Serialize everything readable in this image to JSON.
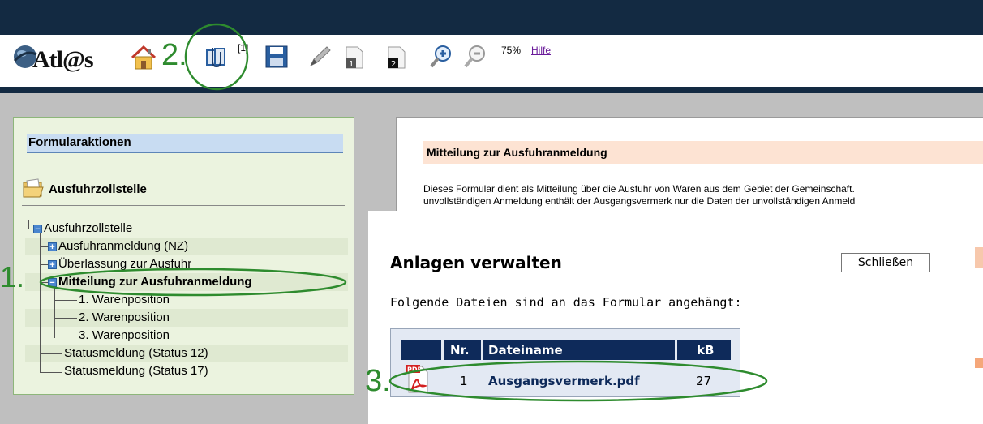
{
  "toolbar": {
    "logo_text": "Atl@s",
    "annotation_2": "2.",
    "attachments_count": "[1]",
    "zoom_level": "75%",
    "help_label": "Hilfe",
    "icons": [
      "home-icon",
      "attachments-icon",
      "save-icon",
      "pen-icon",
      "page-1-icon",
      "page-2-icon",
      "zoom-in-icon",
      "zoom-out-icon"
    ]
  },
  "sidebar": {
    "header": "Formularaktionen",
    "customs_office_title": "Ausfuhrzollstelle",
    "annotation_1": "1.",
    "tree": [
      {
        "label": "Ausfuhrzollstelle"
      },
      {
        "label": "Ausfuhranmeldung (NZ)"
      },
      {
        "label": "Überlassung zur Ausfuhr"
      },
      {
        "label": "Mitteilung zur Ausfuhranmeldung"
      },
      {
        "label": "1. Warenposition"
      },
      {
        "label": "2. Warenposition"
      },
      {
        "label": "3. Warenposition"
      },
      {
        "label": "Statusmeldung (Status 12)"
      },
      {
        "label": "Statusmeldung (Status 17)"
      }
    ]
  },
  "form": {
    "title": "Mitteilung zur Ausfuhranmeldung",
    "description_line1": "Dieses Formular dient als Mitteilung über die Ausfuhr von Waren aus dem Gebiet der Gemeinschaft.",
    "description_line2": "unvollständigen Anmeldung enthält der Ausgangsvermerk nur die Daten der unvollständigen Anmeld"
  },
  "dialog": {
    "title": "Anlagen verwalten",
    "close_label": "Schließen",
    "subtitle": "Folgende Dateien sind an das Formular angehängt:",
    "annotation_3": "3.",
    "columns": {
      "nr": "Nr.",
      "filename": "Dateiname",
      "kb": "kB"
    },
    "files": [
      {
        "nr": "1",
        "filename": "Ausgangsvermerk.pdf",
        "kb": "27",
        "icon_badge": "PDF"
      }
    ]
  },
  "colors": {
    "navy": "#132a42",
    "annotation_green": "#2e8b2e",
    "panel_green": "#ebf3df",
    "form_header_peach": "#fde3d3",
    "table_header_navy": "#0e2a5a"
  }
}
